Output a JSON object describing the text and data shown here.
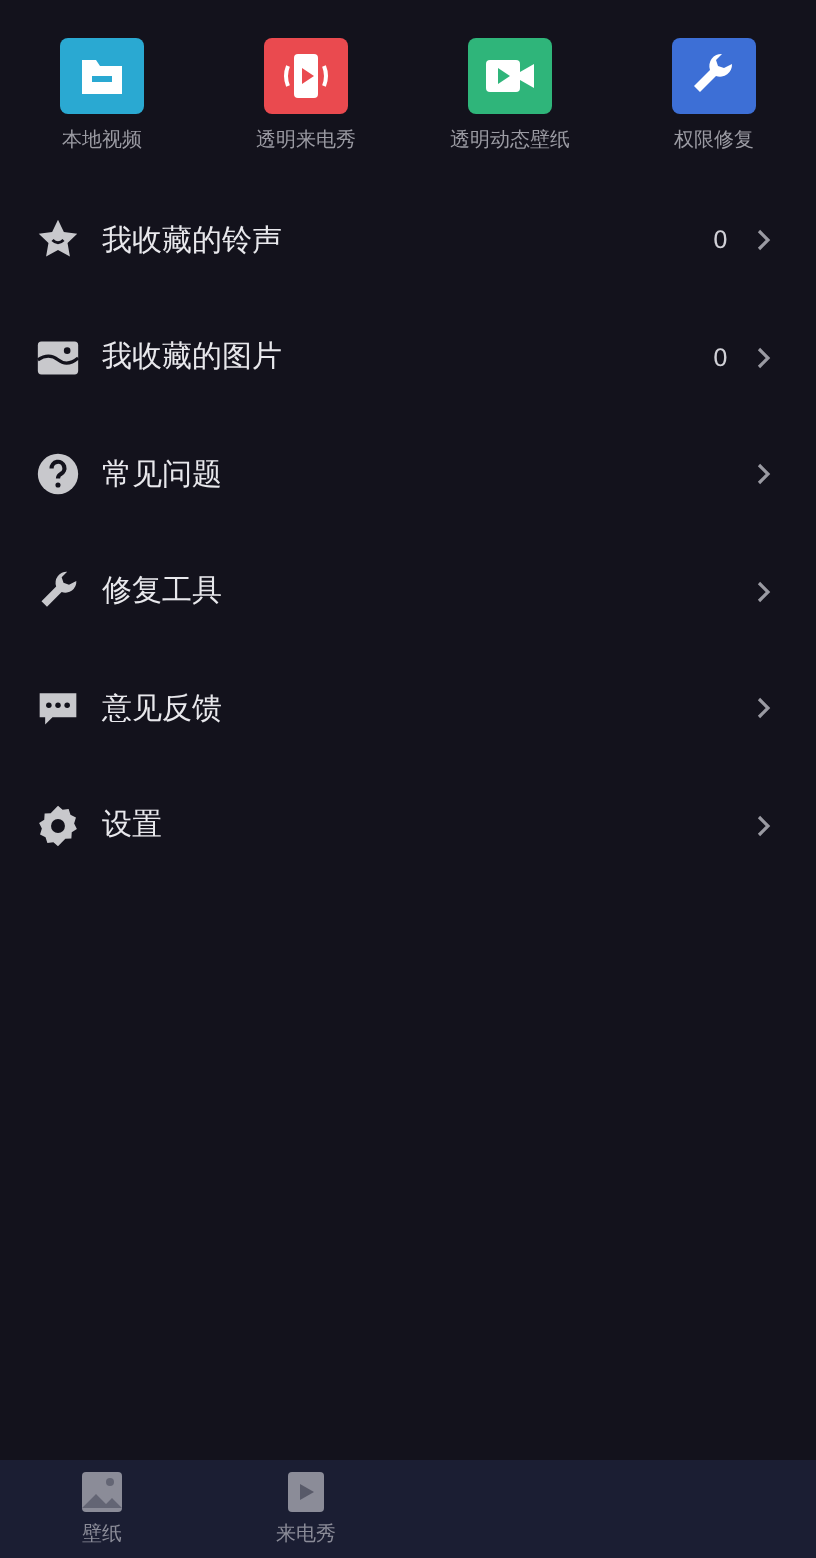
{
  "shortcuts": [
    {
      "label": "本地视频",
      "kind": "folder",
      "color": "#2aa9d2"
    },
    {
      "label": "透明来电秀",
      "kind": "phone",
      "color": "#ea4a4f"
    },
    {
      "label": "透明动态壁纸",
      "kind": "video",
      "color": "#2fb57a"
    },
    {
      "label": "权限修复",
      "kind": "wrench",
      "color": "#3d6fd6"
    }
  ],
  "menu": [
    {
      "label": "我收藏的铃声",
      "kind": "star",
      "count": "0"
    },
    {
      "label": "我收藏的图片",
      "kind": "image",
      "count": "0"
    },
    {
      "label": "常见问题",
      "kind": "question"
    },
    {
      "label": "修复工具",
      "kind": "wrench"
    },
    {
      "label": "意见反馈",
      "kind": "chat"
    },
    {
      "label": "设置",
      "kind": "gear"
    }
  ],
  "tab_bar": [
    {
      "label": "壁纸",
      "kind": "image",
      "selected": false
    },
    {
      "label": "来电秀",
      "kind": "play",
      "selected": false
    }
  ]
}
